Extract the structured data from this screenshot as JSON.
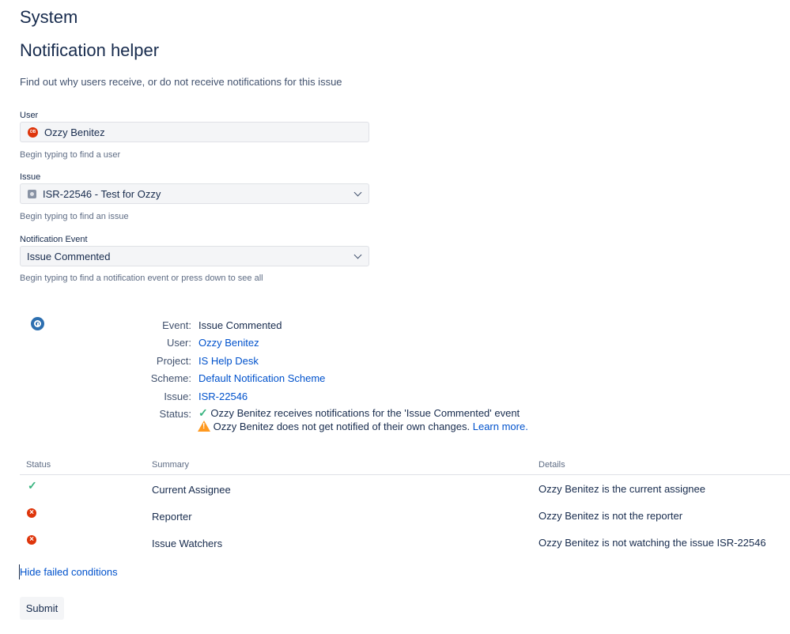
{
  "page": {
    "title": "System",
    "heading": "Notification helper",
    "description": "Find out why users receive, or do not receive notifications for this issue"
  },
  "form": {
    "user": {
      "label": "User",
      "value": "Ozzy Benitez",
      "avatar_initials": "OB",
      "hint": "Begin typing to find a user"
    },
    "issue": {
      "label": "Issue",
      "value": "ISR-22546 - Test for Ozzy",
      "hint": "Begin typing to find an issue"
    },
    "event": {
      "label": "Notification Event",
      "value": "Issue Commented",
      "hint": "Begin typing to find a notification event or press down to see all"
    }
  },
  "result": {
    "event_label": "Event:",
    "event_value": "Issue Commented",
    "user_label": "User:",
    "user_value": "Ozzy Benitez",
    "project_label": "Project:",
    "project_value": "IS Help Desk",
    "scheme_label": "Scheme:",
    "scheme_value": "Default Notification Scheme",
    "issue_label": "Issue:",
    "issue_value": "ISR-22546",
    "status_label": "Status:",
    "status_ok": "Ozzy Benitez receives notifications for the 'Issue Commented' event",
    "status_warn": "Ozzy Benitez does not get notified of their own changes.",
    "learn_more": "Learn more."
  },
  "table": {
    "headers": [
      "Status",
      "Summary",
      "Details"
    ],
    "rows": [
      {
        "status": "pass",
        "summary": "Current Assignee",
        "details": "Ozzy Benitez is the current assignee"
      },
      {
        "status": "fail",
        "summary": "Reporter",
        "details": "Ozzy Benitez is not the reporter"
      },
      {
        "status": "fail",
        "summary": "Issue Watchers",
        "details": "Ozzy Benitez is not watching the issue ISR-22546"
      }
    ]
  },
  "hide_failed_link": "Hide failed conditions",
  "submit_label": "Submit",
  "colors": {
    "accent": "#0052cc",
    "success": "#36b37e",
    "error": "#de350b",
    "warning": "#ff991f",
    "info": "#2d6fb0"
  }
}
